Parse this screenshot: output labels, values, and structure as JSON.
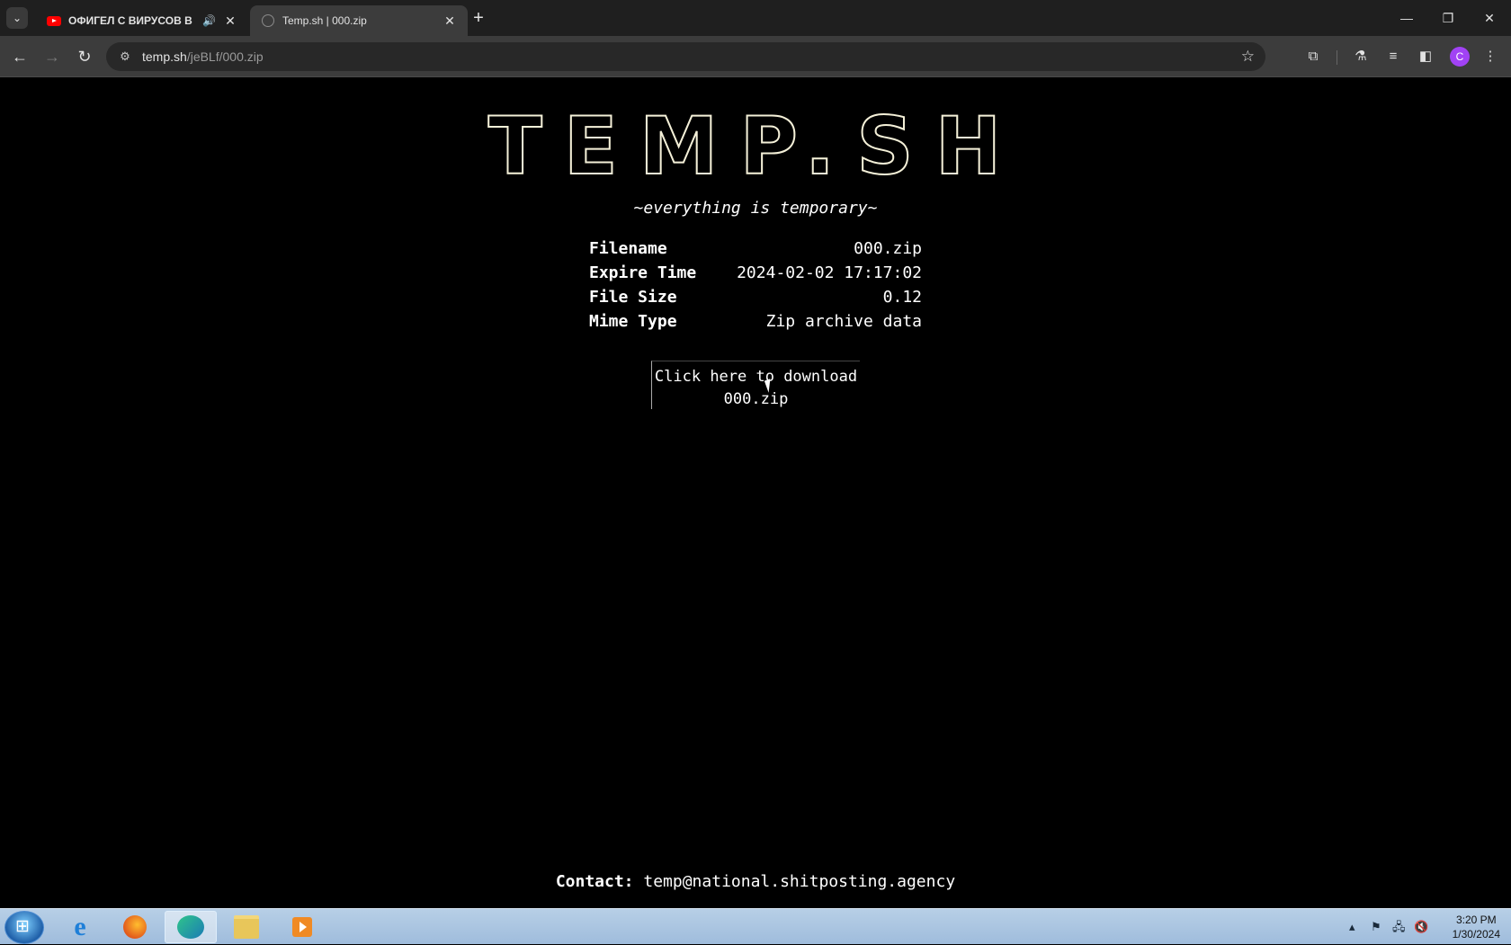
{
  "browser": {
    "tabs": [
      {
        "title": "ОФИГЕЛ С ВИРУСОВ В ВА",
        "favicon": "youtube-icon",
        "audio": true
      },
      {
        "title": "Temp.sh | 000.zip",
        "favicon": "globe-icon",
        "active": true
      }
    ],
    "url_host": "temp.sh",
    "url_path": "/jeBLf/000.zip"
  },
  "page": {
    "logo": "TEMP.SH",
    "tagline": "~everything is temporary~",
    "info": [
      {
        "key": "Filename",
        "value": "000.zip"
      },
      {
        "key": "Expire Time",
        "value": "2024-02-02 17:17:02"
      },
      {
        "key": "File Size",
        "value": "0.12"
      },
      {
        "key": "Mime Type",
        "value": "Zip archive data"
      }
    ],
    "download_line1": "Click here to download",
    "download_line2": "000.zip",
    "contact_label": "Contact:",
    "contact_email": "temp@national.shitposting.agency"
  },
  "taskbar": {
    "time": "3:20 PM",
    "date": "1/30/2024"
  },
  "colors": {
    "page_bg": "#000000",
    "logo_stroke": "#f4f0d8",
    "tabstrip_bg": "#1f1f1f",
    "toolbar_bg": "#3c3c3c"
  }
}
